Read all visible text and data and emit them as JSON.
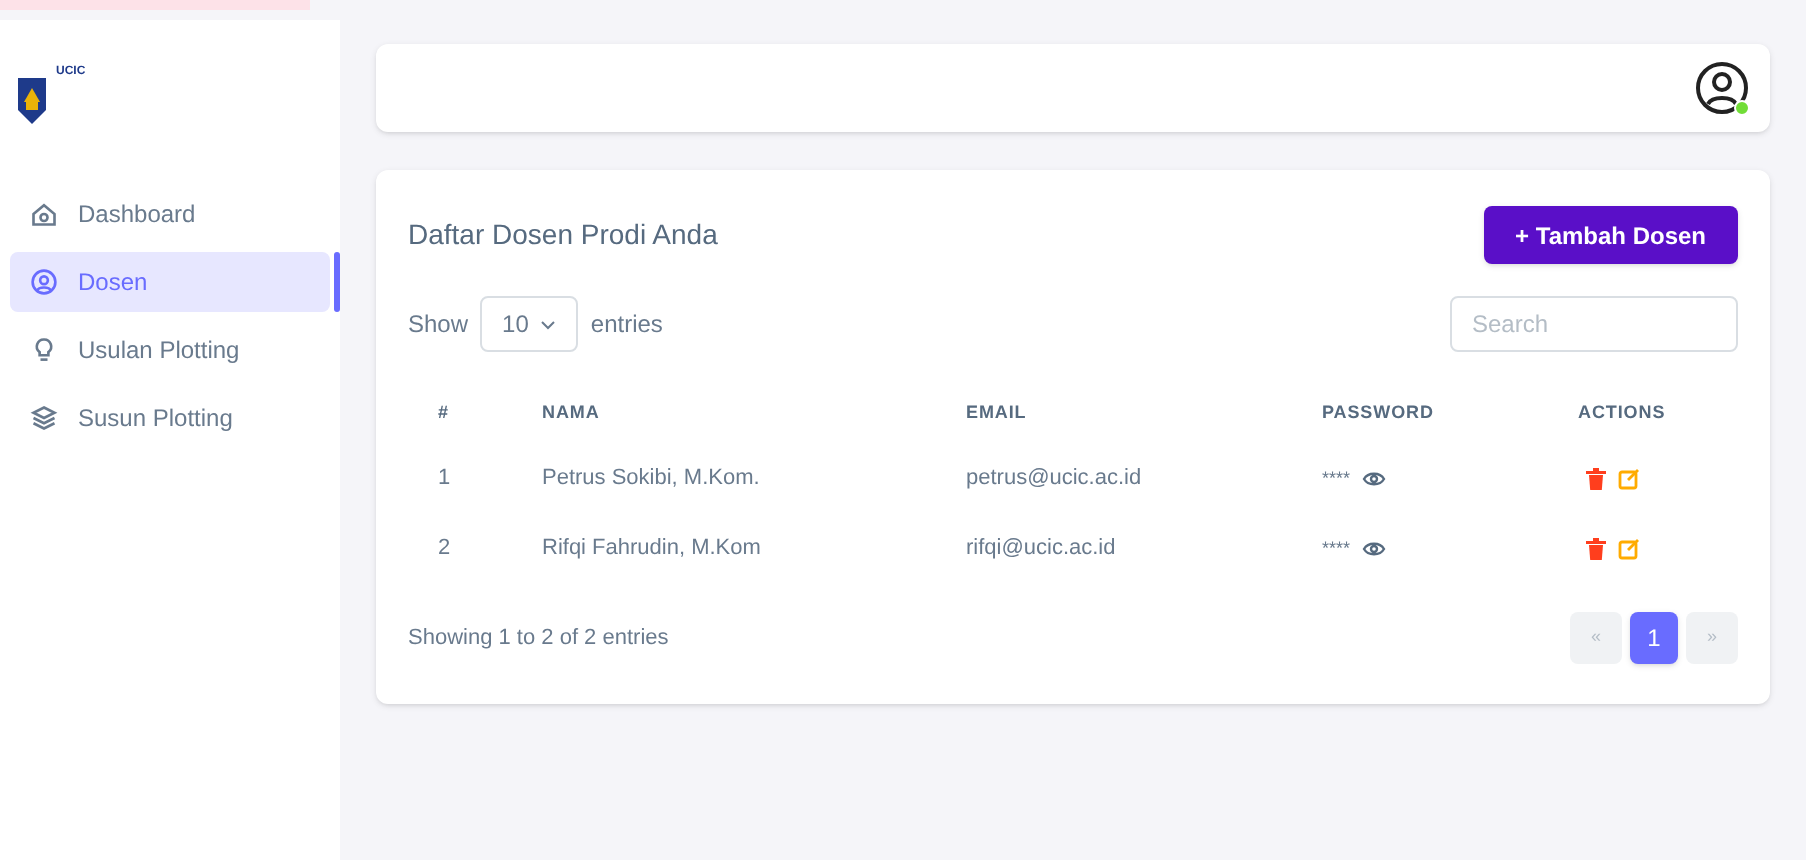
{
  "logo": {
    "text": "UCIC"
  },
  "sidebar": {
    "items": [
      {
        "label": "Dashboard",
        "selected": false
      },
      {
        "label": "Dosen",
        "selected": true
      },
      {
        "label": "Usulan Plotting",
        "selected": false
      },
      {
        "label": "Susun Plotting",
        "selected": false
      }
    ]
  },
  "header": {
    "user_online": true
  },
  "card": {
    "title": "Daftar Dosen Prodi Anda",
    "add_button": "+ Tambah Dosen",
    "show_label": "Show",
    "page_size": "10",
    "entries_label": "entries",
    "search": {
      "placeholder": "Search"
    },
    "table": {
      "columns": [
        "#",
        "NAMA",
        "EMAIL",
        "PASSWORD",
        "ACTIONS"
      ],
      "rows": [
        {
          "no": "1",
          "nama": "Petrus Sokibi, M.Kom.",
          "email": "petrus@ucic.ac.id",
          "password": "****"
        },
        {
          "no": "2",
          "nama": "Rifqi Fahrudin, M.Kom",
          "email": "rifqi@ucic.ac.id",
          "password": "****"
        }
      ]
    },
    "info": "Showing 1 to 2 of 2 entries",
    "pagination": {
      "prev": "«",
      "next": "»",
      "pages": [
        {
          "label": "1",
          "selected": true
        }
      ]
    }
  }
}
